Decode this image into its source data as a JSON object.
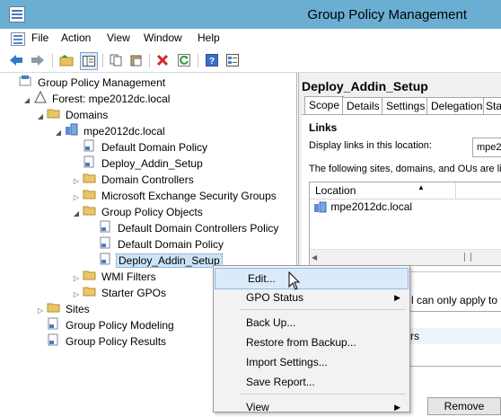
{
  "window": {
    "title": "Group Policy Management"
  },
  "menu": [
    "File",
    "Action",
    "View",
    "Window",
    "Help"
  ],
  "toolbar": {
    "icons": [
      "back-arrow-icon",
      "forward-arrow-icon",
      "up-folder-icon",
      "show-hide-tree-icon",
      "copy-icon",
      "paste-icon",
      "delete-icon",
      "refresh-icon",
      "help-icon",
      "properties-icon"
    ]
  },
  "tree": [
    {
      "label": "Group Policy Management",
      "indent": 0,
      "icon": "gpm",
      "exp": ""
    },
    {
      "label": "Forest: mpe2012dc.local",
      "indent": 1,
      "icon": "forest",
      "exp": "down"
    },
    {
      "label": "Domains",
      "indent": 2,
      "icon": "folder",
      "exp": "down"
    },
    {
      "label": "mpe2012dc.local",
      "indent": 3,
      "icon": "domain",
      "exp": "down"
    },
    {
      "label": "Default Domain Policy",
      "indent": 4,
      "icon": "gpo",
      "exp": ""
    },
    {
      "label": "Deploy_Addin_Setup",
      "indent": 4,
      "icon": "gpo",
      "exp": ""
    },
    {
      "label": "Domain Controllers",
      "indent": 4,
      "icon": "folder",
      "exp": "right"
    },
    {
      "label": "Microsoft Exchange Security Groups",
      "indent": 4,
      "icon": "folder",
      "exp": "right"
    },
    {
      "label": "Group Policy Objects",
      "indent": 4,
      "icon": "folder",
      "exp": "down"
    },
    {
      "label": "Default Domain Controllers Policy",
      "indent": 5,
      "icon": "gpo",
      "exp": ""
    },
    {
      "label": "Default Domain Policy",
      "indent": 5,
      "icon": "gpo",
      "exp": ""
    },
    {
      "label": "Deploy_Addin_Setup",
      "indent": 5,
      "icon": "gpo",
      "exp": "",
      "selected": true
    },
    {
      "label": "WMI Filters",
      "indent": 4,
      "icon": "folder",
      "exp": "right"
    },
    {
      "label": "Starter GPOs",
      "indent": 4,
      "icon": "folder",
      "exp": "right"
    },
    {
      "label": "Sites",
      "indent": 2,
      "icon": "folder",
      "exp": "right"
    },
    {
      "label": "Group Policy Modeling",
      "indent": 2,
      "icon": "gpo",
      "exp": ""
    },
    {
      "label": "Group Policy Results",
      "indent": 2,
      "icon": "gpo",
      "exp": ""
    }
  ],
  "right": {
    "title": "Deploy_Addin_Setup",
    "tabs": [
      "Scope",
      "Details",
      "Settings",
      "Delegation",
      "Sta"
    ],
    "links_heading": "Links",
    "display_links_label": "Display links in this location:",
    "display_links_value": "mpe20",
    "sites_text": "The following sites, domains, and OUs are link",
    "location_header": "Location",
    "location_row": "mpe2012dc.local",
    "filter_text": "l can only apply to the",
    "frag_text": "rs",
    "remove_label": "Remove"
  },
  "context_menu": {
    "items": [
      {
        "label": "Edit...",
        "submenu": false,
        "highlight": true
      },
      {
        "label": "GPO Status",
        "submenu": true
      },
      {
        "sep": true
      },
      {
        "label": "Back Up...",
        "submenu": false
      },
      {
        "label": "Restore from Backup...",
        "submenu": false
      },
      {
        "label": "Import Settings...",
        "submenu": false
      },
      {
        "label": "Save Report...",
        "submenu": false
      },
      {
        "sep": true
      },
      {
        "label": "View",
        "submenu": true
      }
    ]
  }
}
